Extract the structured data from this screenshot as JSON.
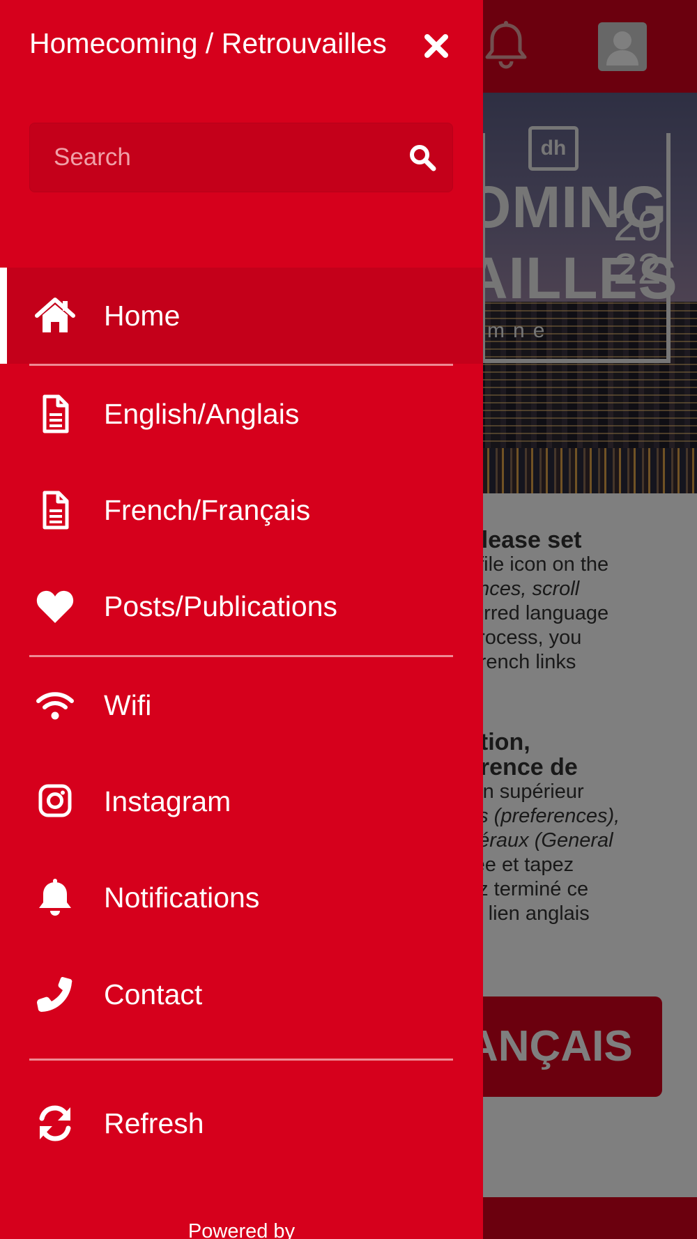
{
  "colors": {
    "brand_red": "#d6001c",
    "brand_red_dark": "#c4001a",
    "text_white": "#ffffff"
  },
  "drawer": {
    "title": "Homecoming / Retrouvailles",
    "search_placeholder": "Search",
    "items": [
      {
        "label": "Home",
        "icon": "home-icon",
        "active": true
      },
      {
        "label": "English/Anglais",
        "icon": "document-icon"
      },
      {
        "label": "French/Français",
        "icon": "document-icon"
      },
      {
        "label": "Posts/Publications",
        "icon": "heart-icon"
      },
      {
        "label": "Wifi",
        "icon": "wifi-icon"
      },
      {
        "label": "Instagram",
        "icon": "instagram-icon"
      },
      {
        "label": "Notifications",
        "icon": "bell-icon"
      },
      {
        "label": "Contact",
        "icon": "phone-icon"
      },
      {
        "label": "Refresh",
        "icon": "refresh-icon"
      }
    ],
    "footer": "Powered by"
  },
  "background": {
    "banner": {
      "logo": "dh",
      "line1": "OMING",
      "line2": "AILLES",
      "year_top": "20",
      "year_bottom": "22",
      "season": "tomne"
    },
    "para_en": [
      "please set",
      "ofile icon on the",
      "ences, scroll",
      "ferred language",
      "process, you",
      "French links"
    ],
    "para_fr": [
      "ation,",
      "érence de",
      "oin supérieur",
      "es (preferences),",
      "néraux (General",
      "rée et tapez",
      "ez terminé ce",
      "le lien anglais"
    ],
    "button_label": "ANÇAIS"
  }
}
